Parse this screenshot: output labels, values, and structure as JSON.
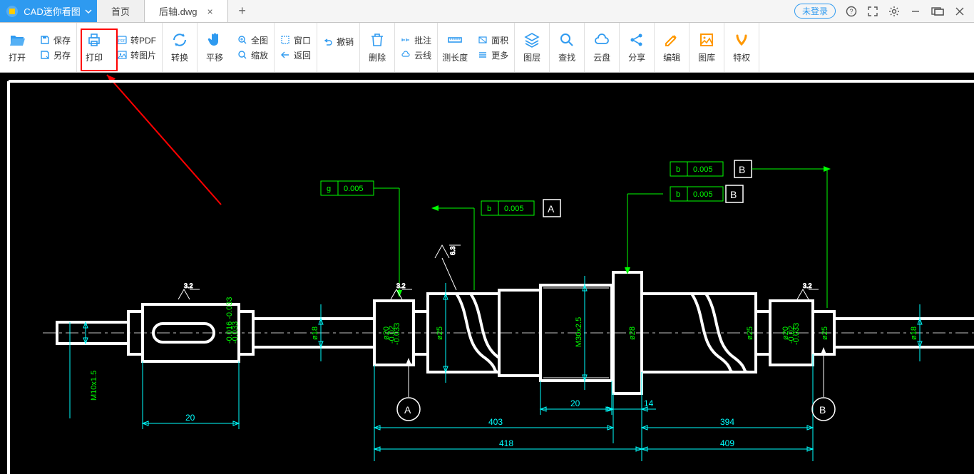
{
  "app": {
    "name": "CAD迷你看图"
  },
  "tabs": {
    "home": "首页",
    "file": "后轴.dwg"
  },
  "title_right": {
    "login": "未登录"
  },
  "tb": {
    "open": "打开",
    "save": "保存",
    "saveas": "另存",
    "print": "打印",
    "pdf": "转PDF",
    "img": "转图片",
    "convert": "转换",
    "pan": "平移",
    "fit": "全图",
    "zoom": "缩放",
    "window": "窗口",
    "undo": "撤销",
    "back": "返回",
    "delete": "删除",
    "annot": "批注",
    "cloud": "云线",
    "measure": "测长度",
    "area": "面积",
    "more": "更多",
    "layer": "图层",
    "find": "查找",
    "clouddisk": "云盘",
    "share": "分享",
    "edit": "编辑",
    "gallery": "图库",
    "vip": "特权"
  },
  "cad": {
    "tol": {
      "g": "g",
      "b": "b",
      "val": "0.005",
      "A": "A",
      "B": "B"
    },
    "surf": {
      "ra32": "3.2",
      "ra63": "6.3"
    },
    "diam": {
      "d18": "ø18",
      "d20": "ø20",
      "d25": "ø25",
      "d28": "ø28",
      "m30": "M30x2.5",
      "tol20": "-0.02\n-0.033",
      "tol016": "-0.016\n-0.033"
    },
    "dim": {
      "d20": "20",
      "d20b": "20",
      "d14": "14",
      "d403": "403",
      "d394": "394",
      "d418": "418",
      "d409": "409"
    },
    "thread": "M10x1.5",
    "datum": {
      "A": "A",
      "B": "B"
    }
  }
}
